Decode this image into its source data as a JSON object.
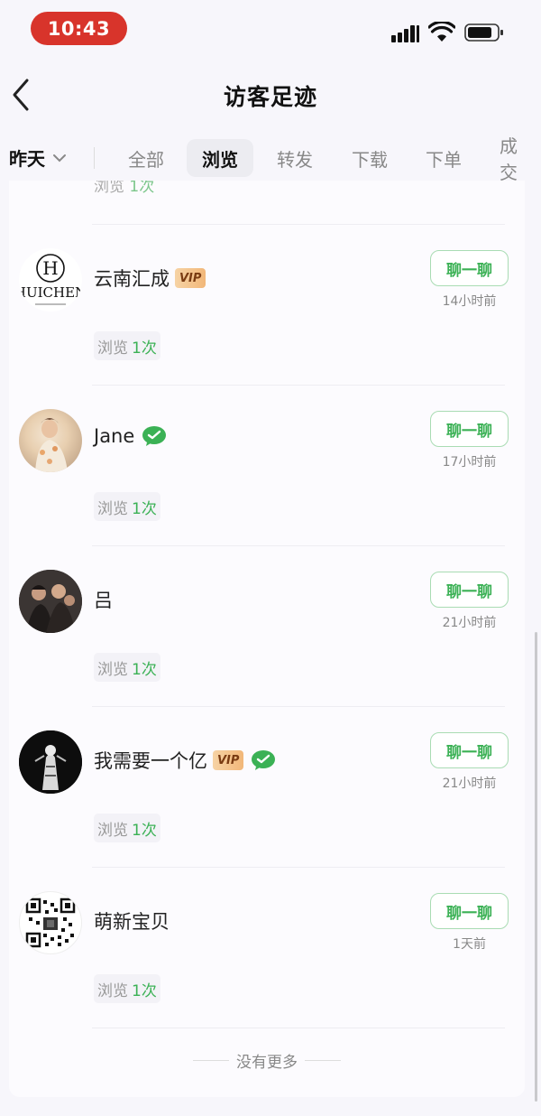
{
  "status": {
    "time": "10:43"
  },
  "nav": {
    "title": "访客足迹"
  },
  "date_filter": {
    "label": "昨天"
  },
  "tabs": [
    {
      "label": "全部"
    },
    {
      "label": "浏览"
    },
    {
      "label": "转发"
    },
    {
      "label": "下载"
    },
    {
      "label": "下单"
    },
    {
      "label": "成交"
    }
  ],
  "active_tab": "浏览",
  "partial_row": {
    "views_label": "浏览",
    "views_count": "1次"
  },
  "visitors": [
    {
      "name": "云南汇成",
      "vip": "VIP",
      "wechat": false,
      "chat": "聊一聊",
      "time_ago": "14小时前",
      "views_label": "浏览",
      "views_count": "1次",
      "avatar_text": "HUICHEN"
    },
    {
      "name": "Jane",
      "vip": "",
      "wechat": true,
      "chat": "聊一聊",
      "time_ago": "17小时前",
      "views_label": "浏览",
      "views_count": "1次"
    },
    {
      "name": "吕",
      "vip": "",
      "wechat": false,
      "chat": "聊一聊",
      "time_ago": "21小时前",
      "views_label": "浏览",
      "views_count": "1次"
    },
    {
      "name": "我需要一个亿",
      "vip": "VIP",
      "wechat": true,
      "chat": "聊一聊",
      "time_ago": "21小时前",
      "views_label": "浏览",
      "views_count": "1次"
    },
    {
      "name": "萌新宝贝",
      "vip": "",
      "wechat": false,
      "chat": "聊一聊",
      "time_ago": "1天前",
      "views_label": "浏览",
      "views_count": "1次"
    }
  ],
  "footer": {
    "no_more": "没有更多"
  },
  "colors": {
    "accent_green": "#3bb155",
    "status_pill": "#d8342b",
    "vip_gold": "#f2b779"
  }
}
